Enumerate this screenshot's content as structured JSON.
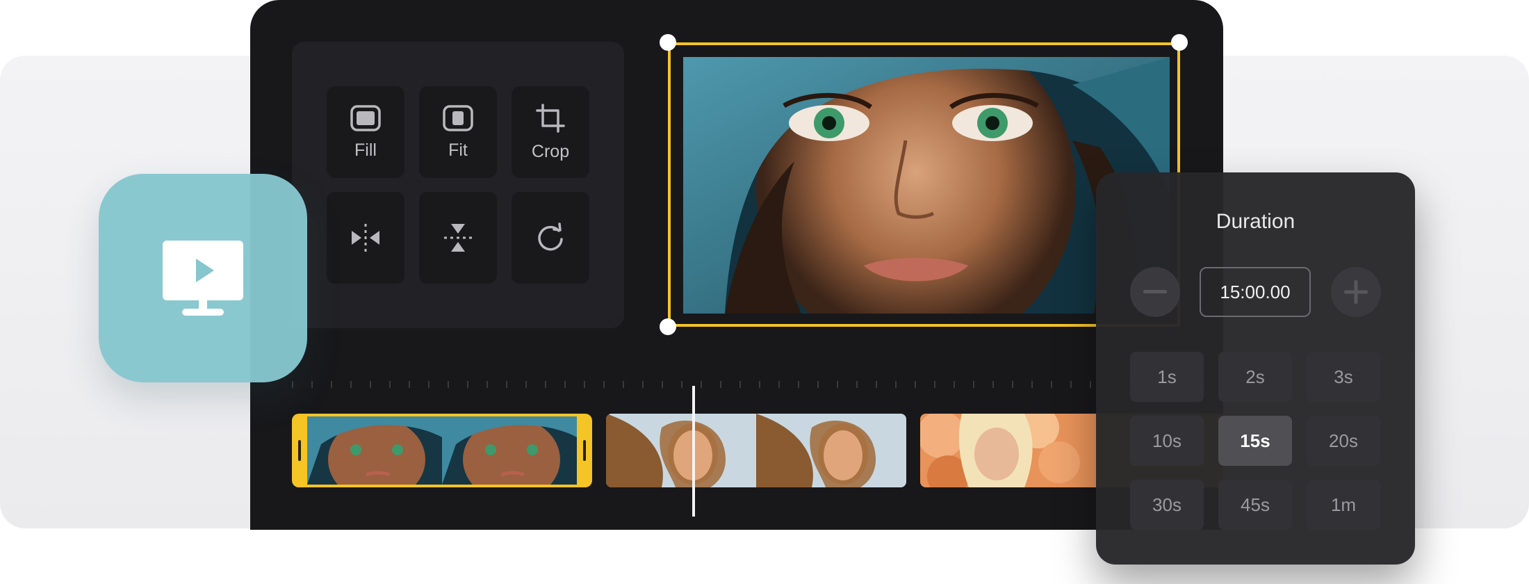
{
  "tools": {
    "fill_label": "Fill",
    "fit_label": "Fit",
    "crop_label": "Crop"
  },
  "icons": {
    "app": "monitor-play-icon",
    "fill": "fill-frame-icon",
    "fit": "fit-frame-icon",
    "crop": "crop-icon",
    "flip_horizontal": "flip-horizontal-icon",
    "flip_vertical": "flip-vertical-icon",
    "rotate": "rotate-clockwise-icon",
    "decrease": "minus-icon",
    "increase": "plus-icon"
  },
  "duration": {
    "title": "Duration",
    "value": "15:00.00",
    "presets": [
      "1s",
      "2s",
      "3s",
      "10s",
      "15s",
      "20s",
      "30s",
      "45s",
      "1m"
    ],
    "selected": "15s"
  },
  "colors": {
    "accent": "#f5c425",
    "app_icon": "#86c6ce",
    "editor_bg": "#18181b"
  }
}
